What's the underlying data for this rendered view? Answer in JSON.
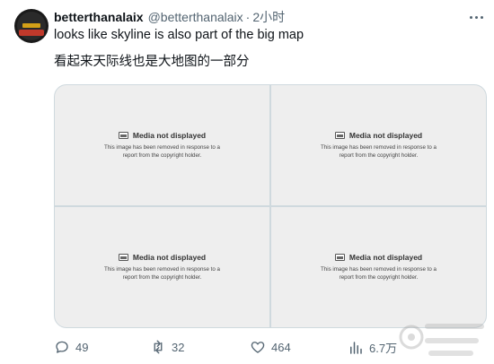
{
  "tweet": {
    "display_name": "betterthanalaix",
    "handle": "@betterthanalaix",
    "separator": "·",
    "time": "2小时",
    "text_line1": "looks like skyline is also part of the big map",
    "text_line2": "看起来天际线也是大地图的一部分"
  },
  "media": {
    "items": [
      {
        "title": "Media not displayed",
        "desc_line1": "This image has been removed in response to a",
        "desc_line2": "report from the copyright holder."
      },
      {
        "title": "Media not displayed",
        "desc_line1": "This image has been removed in response to a",
        "desc_line2": "report from the copyright holder."
      },
      {
        "title": "Media not displayed",
        "desc_line1": "This image has been removed in response to a",
        "desc_line2": "report from the copyright holder."
      },
      {
        "title": "Media not displayed",
        "desc_line1": "This image has been removed in response to a",
        "desc_line2": "report from the copyright holder."
      }
    ]
  },
  "actions": {
    "reply_count": "49",
    "retweet_count": "32",
    "like_count": "464",
    "view_count": "6.7万"
  },
  "icons": {
    "more": "more-horizontal-icon",
    "reply": "reply-icon",
    "retweet": "retweet-icon",
    "like": "heart-icon",
    "views": "views-chart-icon",
    "media_placeholder": "image-icon"
  },
  "colors": {
    "text_primary": "#0f1419",
    "text_secondary": "#536471",
    "border": "#cfd9de",
    "placeholder_bg": "#eeeeee"
  }
}
